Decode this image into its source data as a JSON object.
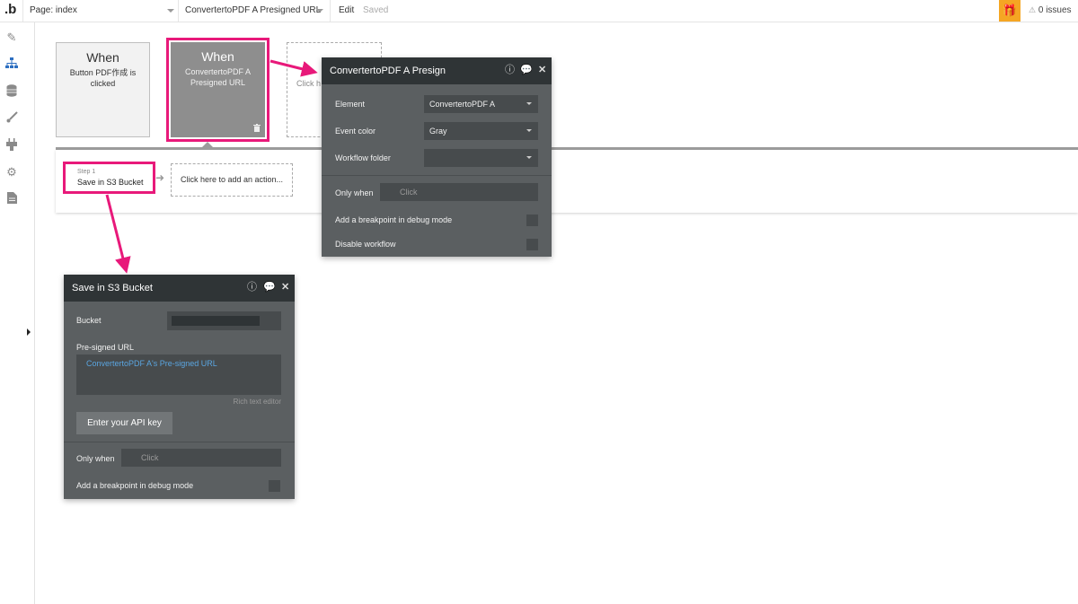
{
  "topbar": {
    "logo": ".b",
    "page": "Page: index",
    "workflow": "ConvertertoPDF A Presigned URL",
    "edit": "Edit",
    "saved": "Saved",
    "issues": "0 issues"
  },
  "sidebar": {
    "icons": [
      "design-icon",
      "workflow-icon",
      "data-icon",
      "styles-icon",
      "plugins-icon",
      "settings-icon",
      "logs-icon"
    ]
  },
  "events": [
    {
      "when": "When",
      "desc": "Button PDF作成 is clicked"
    },
    {
      "when": "When",
      "desc": "ConvertertoPDF A Presigned URL"
    },
    {
      "when": "",
      "desc": "Click h"
    }
  ],
  "step": {
    "number": "Step 1",
    "title": "Save in S3 Bucket",
    "add_action": "Click here to add an action..."
  },
  "event_panel": {
    "title": "ConvertertoPDF A Presign",
    "element_label": "Element",
    "element_value": "ConvertertoPDF A",
    "color_label": "Event color",
    "color_value": "Gray",
    "folder_label": "Workflow folder",
    "folder_value": "",
    "only_when_label": "Only when",
    "only_when_placeholder": "Click",
    "breakpoint_label": "Add a breakpoint in debug mode",
    "disable_label": "Disable workflow"
  },
  "action_panel": {
    "title": "Save in S3 Bucket",
    "bucket_label": "Bucket",
    "presigned_label": "Pre-signed URL",
    "presigned_value": "ConvertertoPDF A's Pre-signed URL",
    "rich_text": "Rich text editor",
    "api_button": "Enter your API key",
    "only_when_label": "Only when",
    "only_when_placeholder": "Click",
    "breakpoint_label": "Add a breakpoint in debug mode"
  },
  "colors": {
    "highlight": "#e8197a",
    "panel_bg": "#5b5f61",
    "panel_head": "#2f3436",
    "link": "#5aa5e0",
    "gift": "#f5a623"
  }
}
